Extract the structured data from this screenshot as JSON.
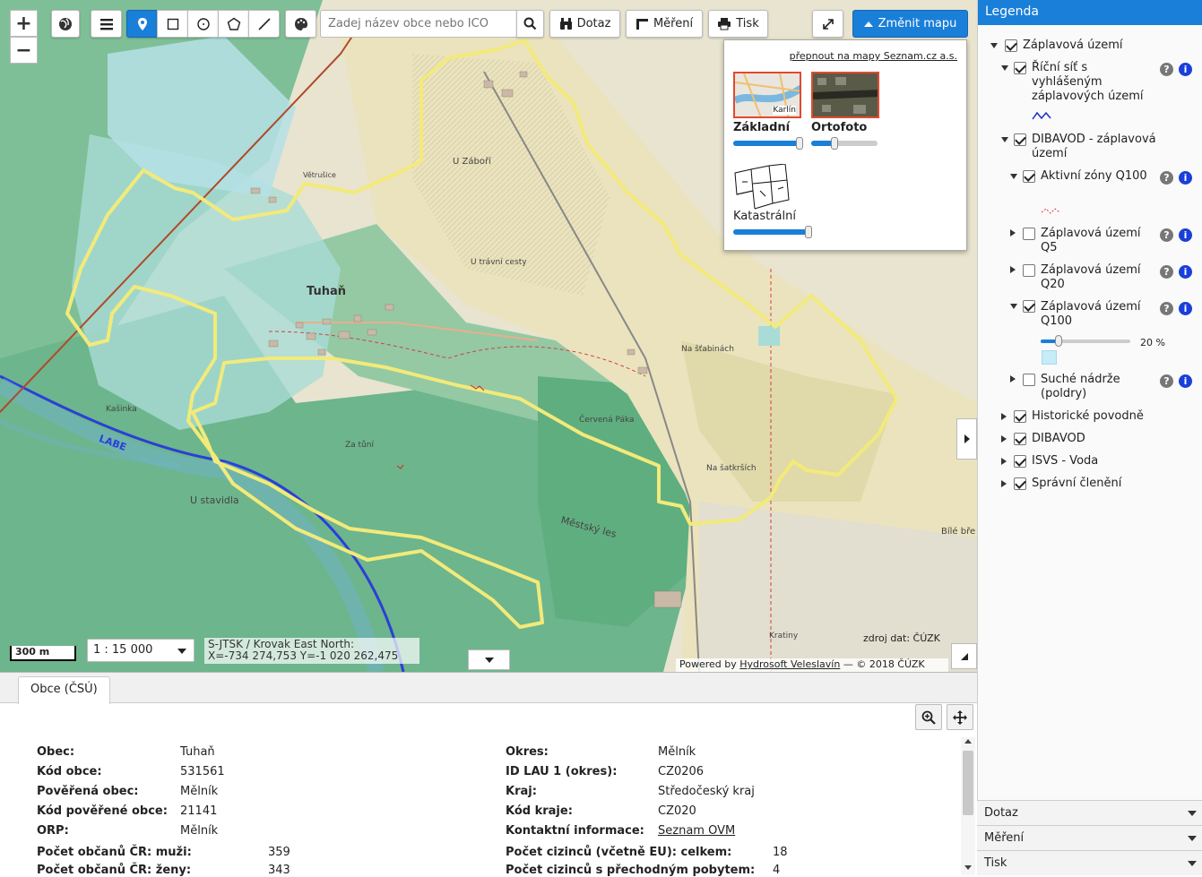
{
  "toolbar": {
    "search_placeholder": "Zadej název obce nebo ICO",
    "query_label": "Dotaz",
    "measure_label": "Měření",
    "print_label": "Tisk",
    "change_map_label": "Změnit mapu",
    "zoom_in": "+",
    "zoom_out": "−"
  },
  "basemap": {
    "switch_link": "přepnout na mapy Seznam.cz a.s.",
    "items": [
      {
        "label": "Základní",
        "opacity": 1.0
      },
      {
        "label": "Ortofoto",
        "opacity": 0.35
      },
      {
        "label": "Katastrální",
        "opacity": 1.0
      }
    ],
    "thumb_tag": "Karlín"
  },
  "map": {
    "scale_bar": "300 m",
    "scale_select": "1 : 15 000",
    "coords_line1": "S-JTSK / Krovak East North:",
    "coords_line2": "X=-734 274,753 Y=-1 020 262,475",
    "source": "zdroj dat: ČÚZK",
    "powered_prefix": "Powered by ",
    "powered_link": "Hydrosoft Veleslavín",
    "powered_suffix": " — © 2018 ČÚZK",
    "labels": {
      "tuhan": "Tuhaň",
      "mestsky_les": "Městský les",
      "u_zaboru": "U Záboří",
      "u_travni_cesty": "U trávní cesty",
      "za_tuni": "Za tůní",
      "u_stavidla": "U stavidla",
      "na_satkrasich": "Na šatkrších",
      "cervena_paka": "Červená Páka",
      "na_strazkovem": "Na šťabinách",
      "bile_bre": "Bílé bře",
      "kratiny": "Kratiny",
      "kasinka": "Kašinka",
      "labe": "LABE",
      "vetrusice": "Větrušice"
    }
  },
  "legend": {
    "title": "Legenda",
    "items": [
      {
        "label": "Záplavová území",
        "checked": true,
        "expanded": true
      },
      {
        "label": "Říční síť s vyhlášeným záplavových území",
        "checked": true,
        "expanded": true
      },
      {
        "label": "DIBAVOD - záplavová území",
        "checked": true,
        "expanded": true
      },
      {
        "label": "Aktivní zóny Q100",
        "checked": true,
        "expanded": true
      },
      {
        "label": "Záplavová území Q5",
        "checked": false,
        "expanded": false
      },
      {
        "label": "Záplavová území Q20",
        "checked": false,
        "expanded": false
      },
      {
        "label": "Záplavová území Q100",
        "checked": true,
        "expanded": true
      },
      {
        "label": "Suché nádrže (poldry)",
        "checked": false,
        "expanded": false
      },
      {
        "label": "Historické povodně",
        "checked": true,
        "expanded": false
      },
      {
        "label": "DIBAVOD",
        "checked": true,
        "expanded": false
      },
      {
        "label": "ISVS - Voda",
        "checked": true,
        "expanded": false
      },
      {
        "label": "Správní členění",
        "checked": true,
        "expanded": false
      }
    ],
    "q100_opacity_label": "20 %",
    "q100_opacity": 0.2,
    "help": "?",
    "info": "i"
  },
  "accordion": {
    "query": "Dotaz",
    "measure": "Měření",
    "print": "Tisk"
  },
  "panel": {
    "tab": "Obce (ČSÚ)",
    "left": [
      {
        "field": "Obec",
        "value": "Tuhaň"
      },
      {
        "field": "Kód obce",
        "value": "531561"
      },
      {
        "field": "Pověřená obec",
        "value": "Mělník"
      },
      {
        "field": "Kód pověřené obce",
        "value": "21141"
      },
      {
        "field": "ORP",
        "value": "Mělník"
      },
      {
        "field": "Počet občanů ČR: muži",
        "value": "359"
      },
      {
        "field": "Počet občanů ČR: ženy",
        "value": "343"
      }
    ],
    "right": [
      {
        "field": "Okres",
        "value": "Mělník"
      },
      {
        "field": "ID LAU 1 (okres)",
        "value": "CZ0206"
      },
      {
        "field": "Kraj",
        "value": "Středočeský kraj"
      },
      {
        "field": "Kód kraje",
        "value": "CZ020"
      },
      {
        "field": "Kontaktní informace",
        "value": "Seznam OVM"
      },
      {
        "field": "Počet cizinců (včetně EU): celkem",
        "value": "18"
      },
      {
        "field": "Počet cizinců s přechodným pobytem",
        "value": "4"
      }
    ]
  }
}
